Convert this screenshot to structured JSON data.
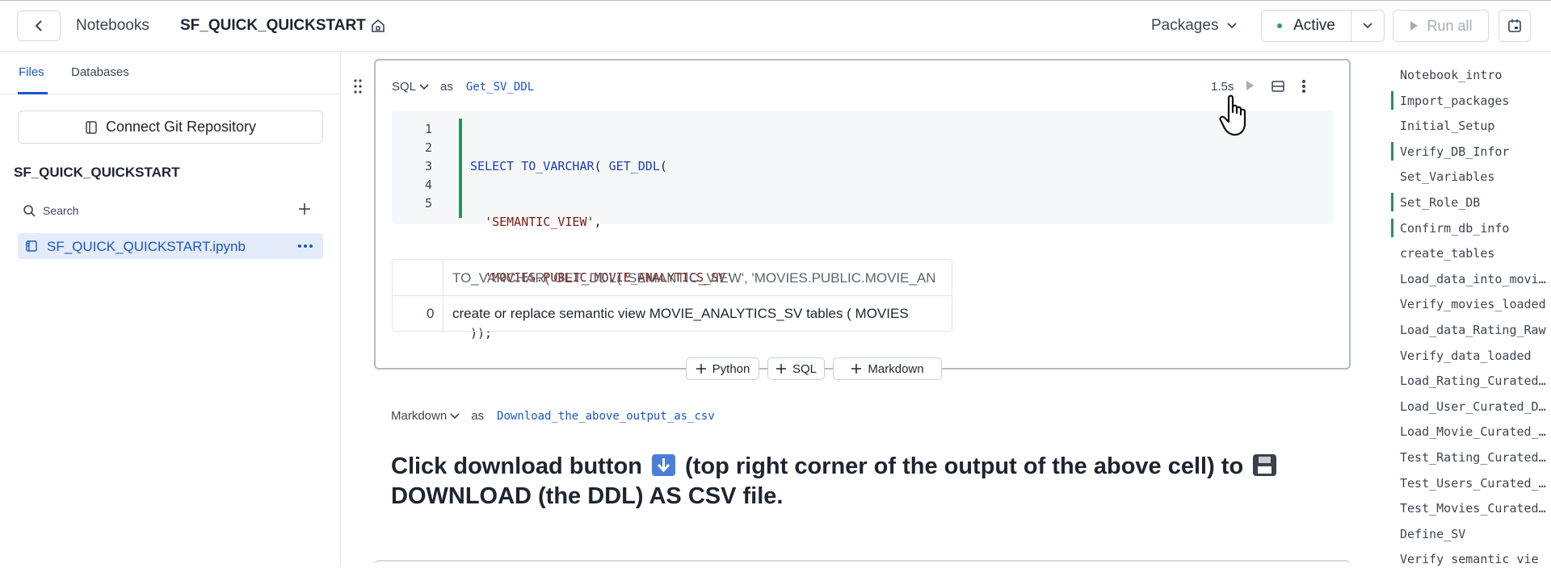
{
  "topbar": {
    "breadcrumb": "Notebooks",
    "title": "SF_QUICK_QUICKSTART",
    "packages_label": "Packages",
    "status_label": "Active",
    "status_color": "#2d9d64",
    "run_all_label": "Run all"
  },
  "sidebar": {
    "tabs": [
      {
        "label": "Files",
        "active": true
      },
      {
        "label": "Databases",
        "active": false
      }
    ],
    "git_button_label": "Connect Git Repository",
    "project_name": "SF_QUICK_QUICKSTART",
    "search_placeholder": "Search",
    "files": [
      {
        "name": "SF_QUICK_QUICKSTART.ipynb",
        "selected": true
      }
    ]
  },
  "cell": {
    "language": "SQL",
    "as_label": "as",
    "name": "Get_SV_DDL",
    "exec_time": "1.5s",
    "line_numbers": [
      "1",
      "2",
      "3",
      "4",
      "5"
    ],
    "code": {
      "l1_kw": "SELECT",
      "l1_fn1": "TO_VARCHAR",
      "l1_p1": "( ",
      "l1_fn2": "GET_DDL",
      "l1_p2": "(",
      "l2_str": "'SEMANTIC_VIEW'",
      "l2_p": ",",
      "l3_str": "'MOVIES.PUBLIC.MOVIE_ANALYTICS_SV'",
      "l4": "));"
    },
    "result": {
      "header": "TO_VARCHAR( GET_DDL(   'SEMANTIC_VIEW',   'MOVIES.PUBLIC.MOVIE_AN",
      "rows": [
        {
          "index": "0",
          "value": "create or replace semantic view MOVIE_ANALYTICS_SV  tables (   MOVIES"
        }
      ]
    }
  },
  "add_buttons": [
    "Python",
    "SQL",
    "Markdown"
  ],
  "markdown_cell": {
    "language": "Markdown",
    "as_label": "as",
    "name": "Download_the_above_output_as_csv",
    "text_part1": "Click download button",
    "text_part2": "(top right corner of the output of the above cell) to",
    "text_part3": "DOWNLOAD (the DDL) AS CSV file.",
    "emoji_download_color": "#4a7fd4",
    "emoji_floppy_color": "#3a3f48"
  },
  "outline": {
    "items": [
      {
        "label": "Notebook_intro",
        "marked": false
      },
      {
        "label": "Import_packages",
        "marked": true
      },
      {
        "label": "Initial_Setup",
        "marked": false
      },
      {
        "label": "Verify_DB_Infor",
        "marked": true
      },
      {
        "label": "Set_Variables",
        "marked": false
      },
      {
        "label": "Set_Role_DB",
        "marked": true
      },
      {
        "label": "Confirm_db_info",
        "marked": true
      },
      {
        "label": "create_tables",
        "marked": false
      },
      {
        "label": "Load_data_into_movi…",
        "marked": false
      },
      {
        "label": "Verify_movies_loaded",
        "marked": false
      },
      {
        "label": "Load_data_Rating_Raw",
        "marked": false
      },
      {
        "label": "Verify_data_loaded",
        "marked": false
      },
      {
        "label": "Load_Rating_Curated…",
        "marked": false
      },
      {
        "label": "Load_User_Curated_D…",
        "marked": false
      },
      {
        "label": "Load_Movie_Curated_…",
        "marked": false
      },
      {
        "label": "Test_Rating_Curated…",
        "marked": false
      },
      {
        "label": "Test_Users_Curated_…",
        "marked": false
      },
      {
        "label": "Test_Movies_Curated…",
        "marked": false
      },
      {
        "label": "Define_SV",
        "marked": false
      },
      {
        "label": "Verify_semantic_vie",
        "marked": false
      }
    ]
  }
}
